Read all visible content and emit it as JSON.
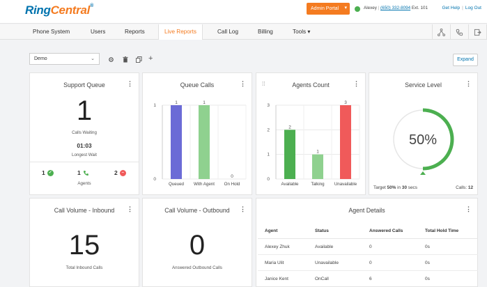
{
  "header": {
    "logo_ring": "Ring",
    "logo_central": "Central",
    "logo_tm": "®",
    "admin_portal": "Admin Portal",
    "user_name": "Alexey",
    "user_phone": "(650) 332-8094",
    "user_ext": "Ext. 101",
    "get_help": "Get Help",
    "log_out": "Log Out"
  },
  "nav": {
    "items": [
      "Phone System",
      "Users",
      "Reports",
      "Live Reports",
      "Call Log",
      "Billing",
      "Tools"
    ],
    "active": "Live Reports",
    "tools_caret": "▾"
  },
  "toolbar": {
    "queue_select": "Demo",
    "expand": "Expand"
  },
  "support_queue": {
    "title": "Support Queue",
    "calls_waiting_value": "1",
    "calls_waiting_label": "Calls Waiting",
    "longest_wait_value": "01:03",
    "longest_wait_label": "Longest Wait",
    "agents_available": "1",
    "agents_talking": "1",
    "agents_unavailable": "2",
    "agents_label": "Agents"
  },
  "queue_calls": {
    "title": "Queue Calls"
  },
  "agents_count": {
    "title": "Agents Count"
  },
  "service_level": {
    "title": "Service Level",
    "percent": 50,
    "percent_text": "50%",
    "target_prefix": "Target",
    "target_value": "50%",
    "target_mid": "in",
    "target_secs": "30",
    "target_suffix": "secs",
    "calls_label": "Calls:",
    "calls_value": "12"
  },
  "call_volume_inbound": {
    "title": "Call Volume - Inbound",
    "value": "15",
    "label": "Total Inbound Calls"
  },
  "call_volume_outbound": {
    "title": "Call Volume - Outbound",
    "value": "0",
    "label": "Answered Outbound Calls"
  },
  "agent_details": {
    "title": "Agent Details",
    "columns": [
      "Agent",
      "Status",
      "Answered Calls",
      "Total Hold Time"
    ],
    "rows": [
      [
        "Alexey Zhuk",
        "Available",
        "0",
        "0s"
      ],
      [
        "Maria Ulit",
        "Unavailable",
        "0",
        "0s"
      ],
      [
        "Janice Kent",
        "OnCall",
        "6",
        "0s"
      ]
    ]
  },
  "colors": {
    "brand_blue": "#0073ae",
    "brand_orange": "#f47b20",
    "green": "#4caf50",
    "light_green": "#8fd18f",
    "red": "#f05a5a",
    "purple": "#6b6bd6"
  },
  "chart_data": [
    {
      "type": "bar",
      "title": "Queue Calls",
      "categories": [
        "Queued",
        "With Agent",
        "On Hold"
      ],
      "values": [
        1,
        1,
        0
      ],
      "ylim": [
        0,
        1
      ],
      "yticks": [
        0,
        1
      ],
      "colors": [
        "#6b6bd6",
        "#8fd18f",
        "#8fd18f"
      ],
      "grid": true
    },
    {
      "type": "bar",
      "title": "Agents Count",
      "categories": [
        "Available",
        "Talking",
        "Unavailable"
      ],
      "values": [
        2,
        1,
        3
      ],
      "ylim": [
        0,
        3
      ],
      "yticks": [
        0,
        1,
        2,
        3
      ],
      "colors": [
        "#4caf50",
        "#8fd18f",
        "#f05a5a"
      ],
      "grid": true
    }
  ]
}
